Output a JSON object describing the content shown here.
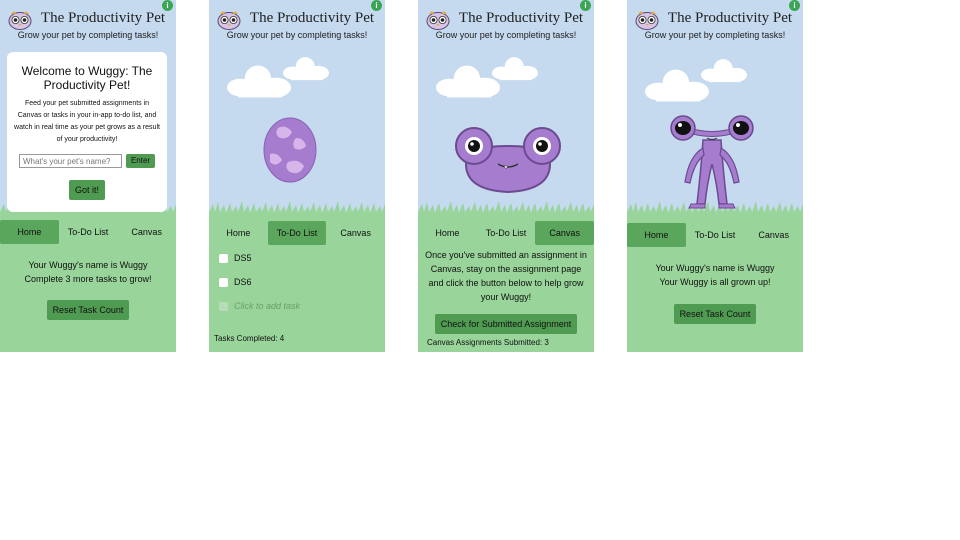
{
  "app": {
    "title": "The Productivity Pet",
    "subtitle": "Grow your pet by completing tasks!",
    "info_glyph": "i"
  },
  "tabs": {
    "home": "Home",
    "todo": "To-Do List",
    "canvas": "Canvas"
  },
  "colors": {
    "sky": "#c5d9ef",
    "grass": "#99d49a",
    "active_tab": "#5aa65c",
    "button": "#4f9b52",
    "pet": "#a67ccf"
  },
  "welcome": {
    "title": "Welcome to Wuggy: The Productivity Pet!",
    "description": "Feed your pet submitted assignments in Canvas or tasks in your in-app to-do list, and watch in real time as your pet grows as a result of your productivity!",
    "name_placeholder": "What's your pet's name?",
    "enter_label": "Enter",
    "got_it_label": "Got it!"
  },
  "home1": {
    "pet_name_line": "Your Wuggy's name is Wuggy",
    "progress_line": "Complete 3 more tasks to grow!",
    "reset_label": "Reset Task Count"
  },
  "todo_screen": {
    "items": [
      "DS5",
      "DS6"
    ],
    "add_placeholder": "Click to add task",
    "tasks_completed": "Tasks Completed: 4"
  },
  "canvas_screen": {
    "instructions": "Once you've submitted an assignment in Canvas, stay on the assignment page and click the button below to help grow your Wuggy!",
    "check_label": "Check for Submitted Assignment",
    "submitted": "Canvas Assignments Submitted: 3"
  },
  "home4": {
    "pet_name_line": "Your Wuggy's name is Wuggy",
    "progress_line": "Your Wuggy is all grown up!",
    "reset_label": "Reset Task Count"
  },
  "icons": [
    "owl-logo-icon",
    "info-icon",
    "cloud-icon",
    "checkbox-icon"
  ]
}
